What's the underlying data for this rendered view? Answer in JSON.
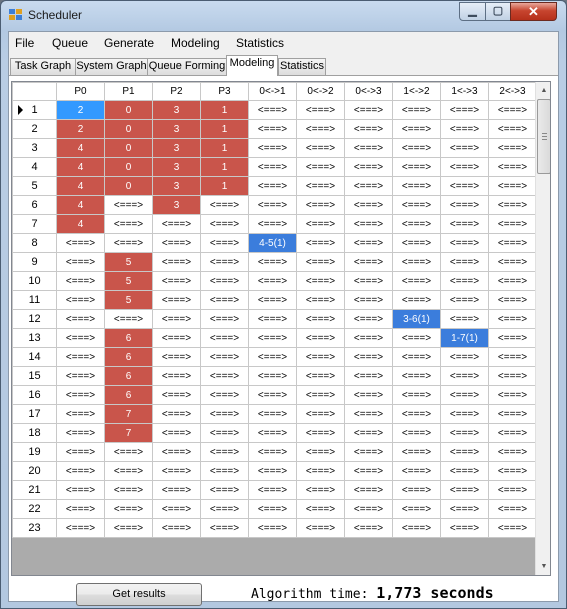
{
  "window": {
    "title": "Scheduler"
  },
  "menu": [
    "File",
    "Queue",
    "Generate",
    "Modeling",
    "Statistics"
  ],
  "tabs": [
    "Task Graph",
    "System Graph",
    "Queue Forming",
    "Modeling",
    "Statistics"
  ],
  "active_tab": "Modeling",
  "grid": {
    "columns": [
      "P0",
      "P1",
      "P2",
      "P3",
      "0<->1",
      "0<->2",
      "0<->3",
      "1<->2",
      "1<->3",
      "2<->3"
    ],
    "selected_row": "1",
    "rows": [
      {
        "label": "1",
        "cells": [
          "2",
          "0",
          "3",
          "1",
          "<===>",
          "<===>",
          "<===>",
          "<===>",
          "<===>",
          "<===>"
        ]
      },
      {
        "label": "2",
        "cells": [
          "2",
          "0",
          "3",
          "1",
          "<===>",
          "<===>",
          "<===>",
          "<===>",
          "<===>",
          "<===>"
        ]
      },
      {
        "label": "3",
        "cells": [
          "4",
          "0",
          "3",
          "1",
          "<===>",
          "<===>",
          "<===>",
          "<===>",
          "<===>",
          "<===>"
        ]
      },
      {
        "label": "4",
        "cells": [
          "4",
          "0",
          "3",
          "1",
          "<===>",
          "<===>",
          "<===>",
          "<===>",
          "<===>",
          "<===>"
        ]
      },
      {
        "label": "5",
        "cells": [
          "4",
          "0",
          "3",
          "1",
          "<===>",
          "<===>",
          "<===>",
          "<===>",
          "<===>",
          "<===>"
        ]
      },
      {
        "label": "6",
        "cells": [
          "4",
          "<===>",
          "3",
          "<===>",
          "<===>",
          "<===>",
          "<===>",
          "<===>",
          "<===>",
          "<===>"
        ]
      },
      {
        "label": "7",
        "cells": [
          "4",
          "<===>",
          "<===>",
          "<===>",
          "<===>",
          "<===>",
          "<===>",
          "<===>",
          "<===>",
          "<===>"
        ]
      },
      {
        "label": "8",
        "cells": [
          "<===>",
          "<===>",
          "<===>",
          "<===>",
          "4-5(1)",
          "<===>",
          "<===>",
          "<===>",
          "<===>",
          "<===>"
        ]
      },
      {
        "label": "9",
        "cells": [
          "<===>",
          "5",
          "<===>",
          "<===>",
          "<===>",
          "<===>",
          "<===>",
          "<===>",
          "<===>",
          "<===>"
        ]
      },
      {
        "label": "10",
        "cells": [
          "<===>",
          "5",
          "<===>",
          "<===>",
          "<===>",
          "<===>",
          "<===>",
          "<===>",
          "<===>",
          "<===>"
        ]
      },
      {
        "label": "11",
        "cells": [
          "<===>",
          "5",
          "<===>",
          "<===>",
          "<===>",
          "<===>",
          "<===>",
          "<===>",
          "<===>",
          "<===>"
        ]
      },
      {
        "label": "12",
        "cells": [
          "<===>",
          "<===>",
          "<===>",
          "<===>",
          "<===>",
          "<===>",
          "<===>",
          "3-6(1)",
          "<===>",
          "<===>"
        ]
      },
      {
        "label": "13",
        "cells": [
          "<===>",
          "6",
          "<===>",
          "<===>",
          "<===>",
          "<===>",
          "<===>",
          "<===>",
          "1-7(1)",
          "<===>"
        ]
      },
      {
        "label": "14",
        "cells": [
          "<===>",
          "6",
          "<===>",
          "<===>",
          "<===>",
          "<===>",
          "<===>",
          "<===>",
          "<===>",
          "<===>"
        ]
      },
      {
        "label": "15",
        "cells": [
          "<===>",
          "6",
          "<===>",
          "<===>",
          "<===>",
          "<===>",
          "<===>",
          "<===>",
          "<===>",
          "<===>"
        ]
      },
      {
        "label": "16",
        "cells": [
          "<===>",
          "6",
          "<===>",
          "<===>",
          "<===>",
          "<===>",
          "<===>",
          "<===>",
          "<===>",
          "<===>"
        ]
      },
      {
        "label": "17",
        "cells": [
          "<===>",
          "7",
          "<===>",
          "<===>",
          "<===>",
          "<===>",
          "<===>",
          "<===>",
          "<===>",
          "<===>"
        ]
      },
      {
        "label": "18",
        "cells": [
          "<===>",
          "7",
          "<===>",
          "<===>",
          "<===>",
          "<===>",
          "<===>",
          "<===>",
          "<===>",
          "<===>"
        ]
      },
      {
        "label": "19",
        "cells": [
          "<===>",
          "<===>",
          "<===>",
          "<===>",
          "<===>",
          "<===>",
          "<===>",
          "<===>",
          "<===>",
          "<===>"
        ]
      },
      {
        "label": "20",
        "cells": [
          "<===>",
          "<===>",
          "<===>",
          "<===>",
          "<===>",
          "<===>",
          "<===>",
          "<===>",
          "<===>",
          "<===>"
        ]
      },
      {
        "label": "21",
        "cells": [
          "<===>",
          "<===>",
          "<===>",
          "<===>",
          "<===>",
          "<===>",
          "<===>",
          "<===>",
          "<===>",
          "<===>"
        ]
      },
      {
        "label": "22",
        "cells": [
          "<===>",
          "<===>",
          "<===>",
          "<===>",
          "<===>",
          "<===>",
          "<===>",
          "<===>",
          "<===>",
          "<===>"
        ]
      },
      {
        "label": "23",
        "cells": [
          "<===>",
          "<===>",
          "<===>",
          "<===>",
          "<===>",
          "<===>",
          "<===>",
          "<===>",
          "<===>",
          "<===>"
        ]
      }
    ]
  },
  "footer": {
    "button_label": "Get results",
    "algo_label": "Algorithm time:",
    "algo_value": "1,773 seconds"
  },
  "colors": {
    "task_cell": "#c9554b",
    "transfer_cell": "#3b7ddc",
    "selected_cell": "#3399ff"
  }
}
